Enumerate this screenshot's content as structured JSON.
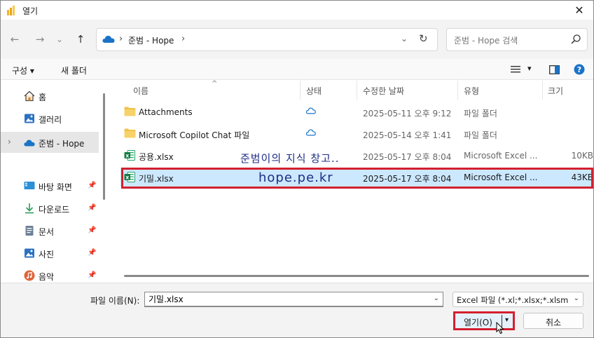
{
  "window": {
    "title": "열기",
    "close_glyph": "✕"
  },
  "nav": {
    "back_glyph": "←",
    "forward_glyph": "→",
    "recent_glyph": "⌄",
    "up_glyph": "↑",
    "address_separator": "›",
    "address_path": "준범 - Hope",
    "address_dropdown_glyph": "⌄",
    "refresh_glyph": "↻",
    "search_placeholder": "준범 - Hope 검색"
  },
  "toolbar": {
    "organize_label": "구성 ▾",
    "new_folder_label": "새 폴더",
    "view_dropdown_glyph": "▾"
  },
  "sidebar": {
    "items": [
      {
        "label": "홈",
        "icon": "home-icon"
      },
      {
        "label": "갤러리",
        "icon": "gallery-icon"
      },
      {
        "label": "준범 - Hope",
        "icon": "onedrive-cloud-icon",
        "selected": true,
        "expander": "›"
      },
      {
        "label": "바탕 화면",
        "icon": "desktop-icon",
        "pinned": true
      },
      {
        "label": "다운로드",
        "icon": "download-icon",
        "pinned": true
      },
      {
        "label": "문서",
        "icon": "documents-icon",
        "pinned": true
      },
      {
        "label": "사진",
        "icon": "pictures-icon",
        "pinned": true
      },
      {
        "label": "음악",
        "icon": "music-icon",
        "pinned": true
      }
    ],
    "pin_glyph": "📌"
  },
  "columns": {
    "name": "이름",
    "status": "상태",
    "modified": "수정한 날짜",
    "type": "유형",
    "size": "크기",
    "sort_glyph": "^"
  },
  "files": [
    {
      "name": "Attachments",
      "icon": "folder-icon",
      "status": "cloud",
      "modified": "2025-05-11 오후 9:12",
      "type": "파일 폴더",
      "size": ""
    },
    {
      "name": "Microsoft Copilot Chat 파일",
      "icon": "folder-icon",
      "status": "cloud",
      "modified": "2025-05-14 오후 1:41",
      "type": "파일 폴더",
      "size": ""
    },
    {
      "name": "공용.xlsx",
      "icon": "excel-icon",
      "status": "synced",
      "modified": "2025-05-17 오후 8:04",
      "type": "Microsoft Excel ...",
      "size": "10KB"
    },
    {
      "name": "기밀.xlsx",
      "icon": "excel-icon",
      "status": "synced",
      "modified": "2025-05-17 오후 8:04",
      "type": "Microsoft Excel ...",
      "size": "43KB",
      "selected": true
    }
  ],
  "overlay": {
    "line1": "준범이의 지식 창고..",
    "line2": "hope.pe.kr"
  },
  "footer": {
    "filename_label": "파일 이름(N):",
    "filename_value": "기밀.xlsx",
    "filter_value": "Excel 파일 (*.xl;*.xlsx;*.xlsm;*.x",
    "dropdown_glyph": "⌄",
    "open_label": "열기(O)",
    "open_split_glyph": "▾",
    "cancel_label": "취소"
  },
  "colors": {
    "highlight_red": "#d3202f",
    "selection_blue": "#cce8ff",
    "overlay_text": "#1f2d86",
    "excel_green": "#107c41",
    "folder_yellow": "#f0c24b",
    "onedrive_blue": "#1a73c8"
  }
}
